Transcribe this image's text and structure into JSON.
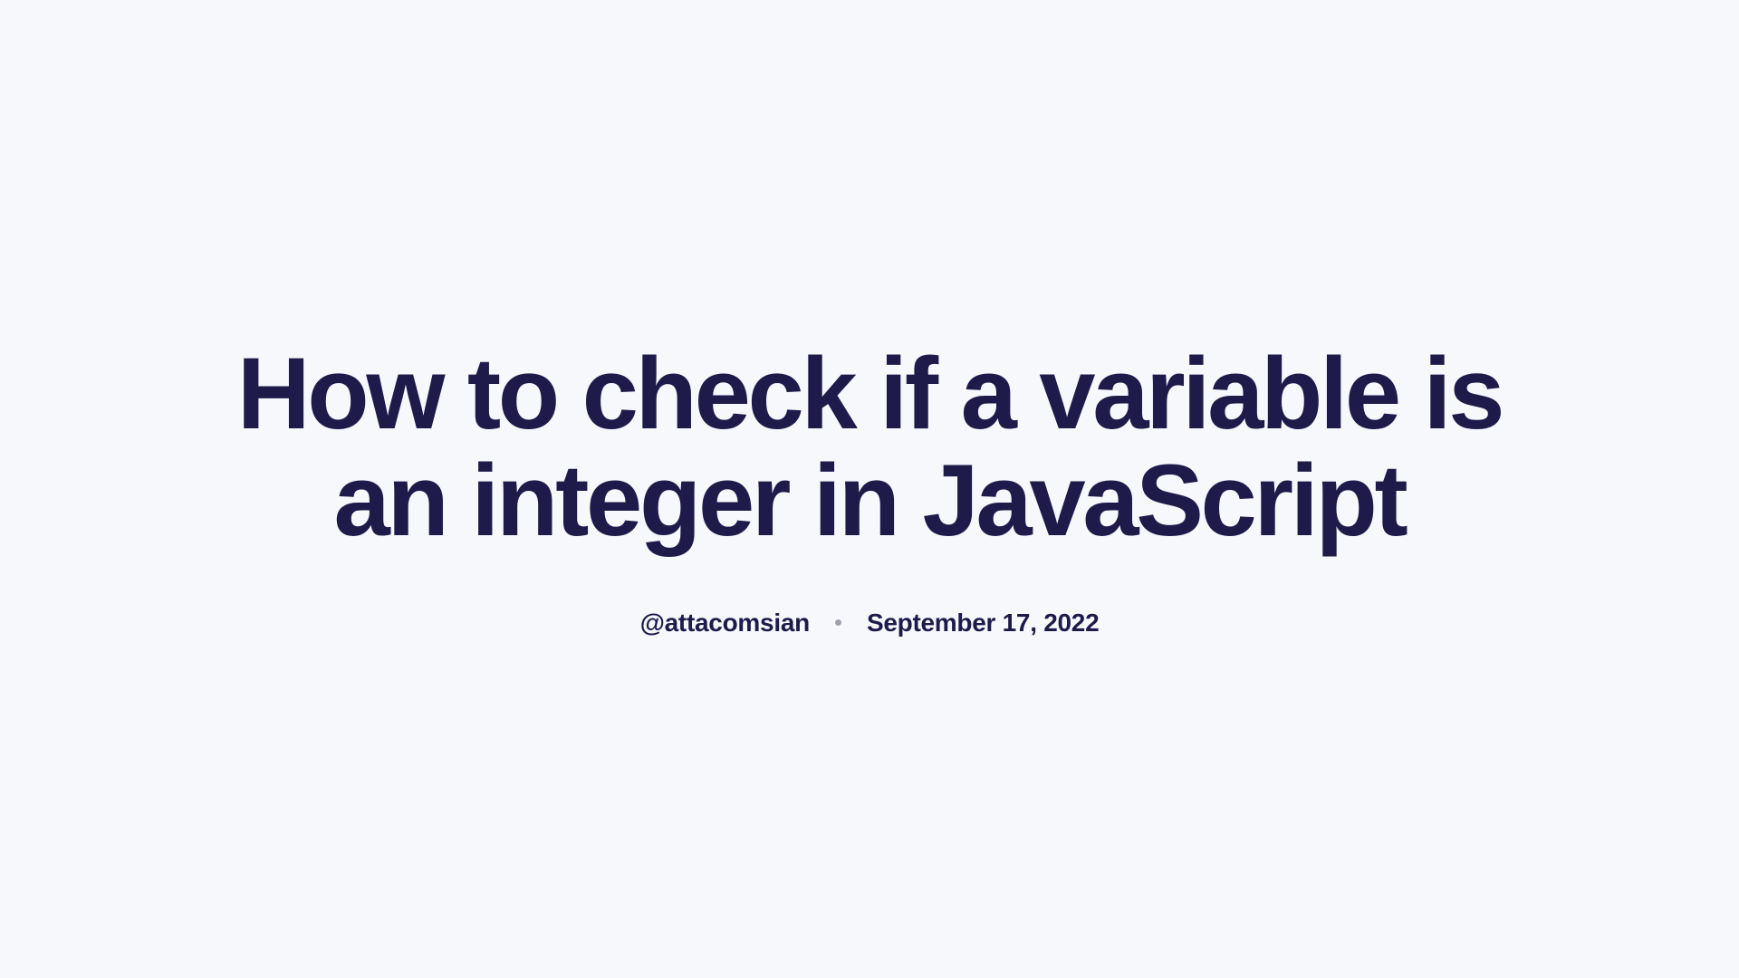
{
  "article": {
    "title": "How to check if a variable is an integer in JavaScript",
    "author": "@attacomsian",
    "date": "September 17, 2022"
  }
}
